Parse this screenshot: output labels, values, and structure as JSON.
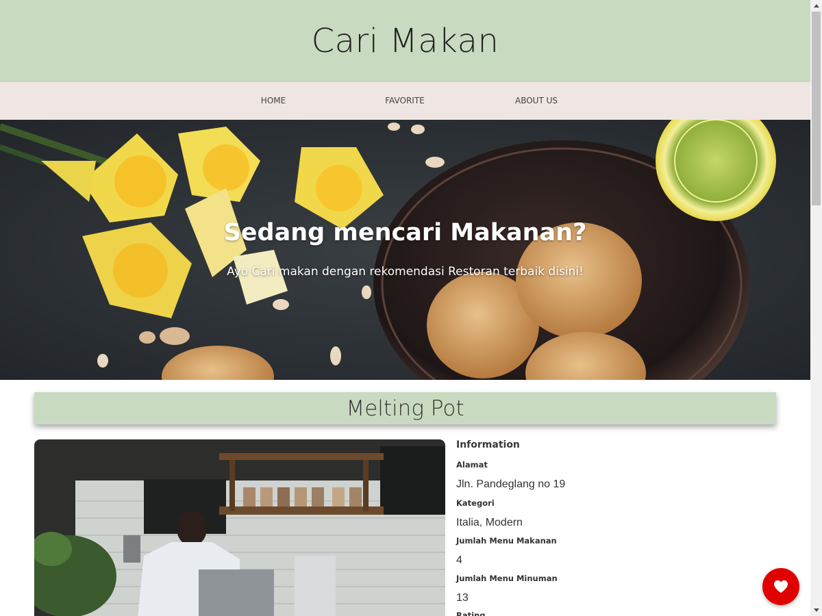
{
  "app": {
    "title": "Cari Makan"
  },
  "nav": {
    "items": [
      {
        "label": "HOME"
      },
      {
        "label": "FAVORITE"
      },
      {
        "label": "ABOUT US"
      }
    ]
  },
  "hero": {
    "title": "Sedang mencari Makanan?",
    "subtitle": "Ayo Cari makan dengan rekomendasi Restoran terbaik disini!"
  },
  "restaurant": {
    "name": "Melting Pot",
    "info_heading": "Information",
    "fields": [
      {
        "label": "Alamat",
        "value": "Jln. Pandeglang no 19"
      },
      {
        "label": "Kategori",
        "value": "Italia, Modern"
      },
      {
        "label": "Jumlah Menu Makanan",
        "value": "4"
      },
      {
        "label": "Jumlah Menu Minuman",
        "value": "13"
      },
      {
        "label": "Rating",
        "value": ""
      }
    ]
  },
  "favorite_button": {
    "icon": "heart-icon",
    "color": "#e00000"
  },
  "colors": {
    "header_bg": "#c8dbc0",
    "nav_bg": "#efe5e2",
    "favorite_red": "#e00000"
  }
}
